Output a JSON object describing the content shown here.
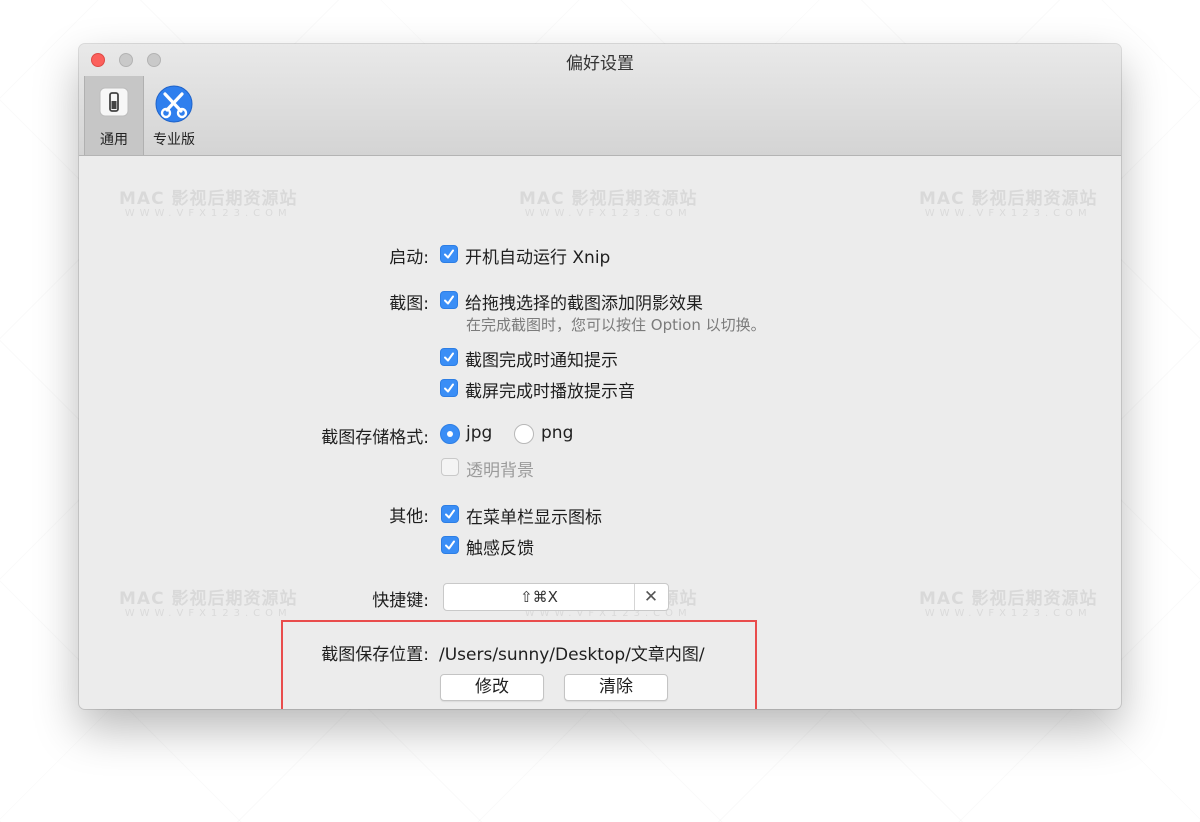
{
  "window": {
    "title": "偏好设置"
  },
  "toolbar": {
    "items": [
      {
        "label": "通用",
        "icon": "switch-icon",
        "selected": true
      },
      {
        "label": "专业版",
        "icon": "xnip-scissors-icon",
        "selected": false
      }
    ]
  },
  "watermark": {
    "main": "MAC 影视后期资源站",
    "sub": "WWW.VFX123.COM"
  },
  "startup": {
    "label": "启动:",
    "launch_at_login": {
      "label": "开机自动运行 Xnip",
      "checked": true
    }
  },
  "capture": {
    "label": "截图:",
    "shadow": {
      "label": "给拖拽选择的截图添加阴影效果",
      "checked": true
    },
    "shadow_hint": "在完成截图时，您可以按住 Option 以切换。",
    "notify": {
      "label": "截图完成时通知提示",
      "checked": true
    },
    "sound": {
      "label": "截屏完成时播放提示音",
      "checked": true
    }
  },
  "format": {
    "label": "截图存储格式:",
    "jpg": {
      "label": "jpg",
      "selected": true
    },
    "png": {
      "label": "png",
      "selected": false
    },
    "transparent": {
      "label": "透明背景",
      "checked": false,
      "disabled": true
    }
  },
  "other": {
    "label": "其他:",
    "menubar_icon": {
      "label": "在菜单栏显示图标",
      "checked": true
    },
    "haptic": {
      "label": "触感反馈",
      "checked": true
    }
  },
  "shortcut": {
    "label": "快捷键:",
    "value": "⇧⌘X",
    "clear": "✕"
  },
  "save_location": {
    "label": "截图保存位置:",
    "path": "/Users/sunny/Desktop/文章内图/",
    "modify_label": "修改",
    "clear_label": "清除"
  },
  "colors": {
    "accent": "#3a8ef6",
    "highlight_border": "#e94c4c"
  }
}
